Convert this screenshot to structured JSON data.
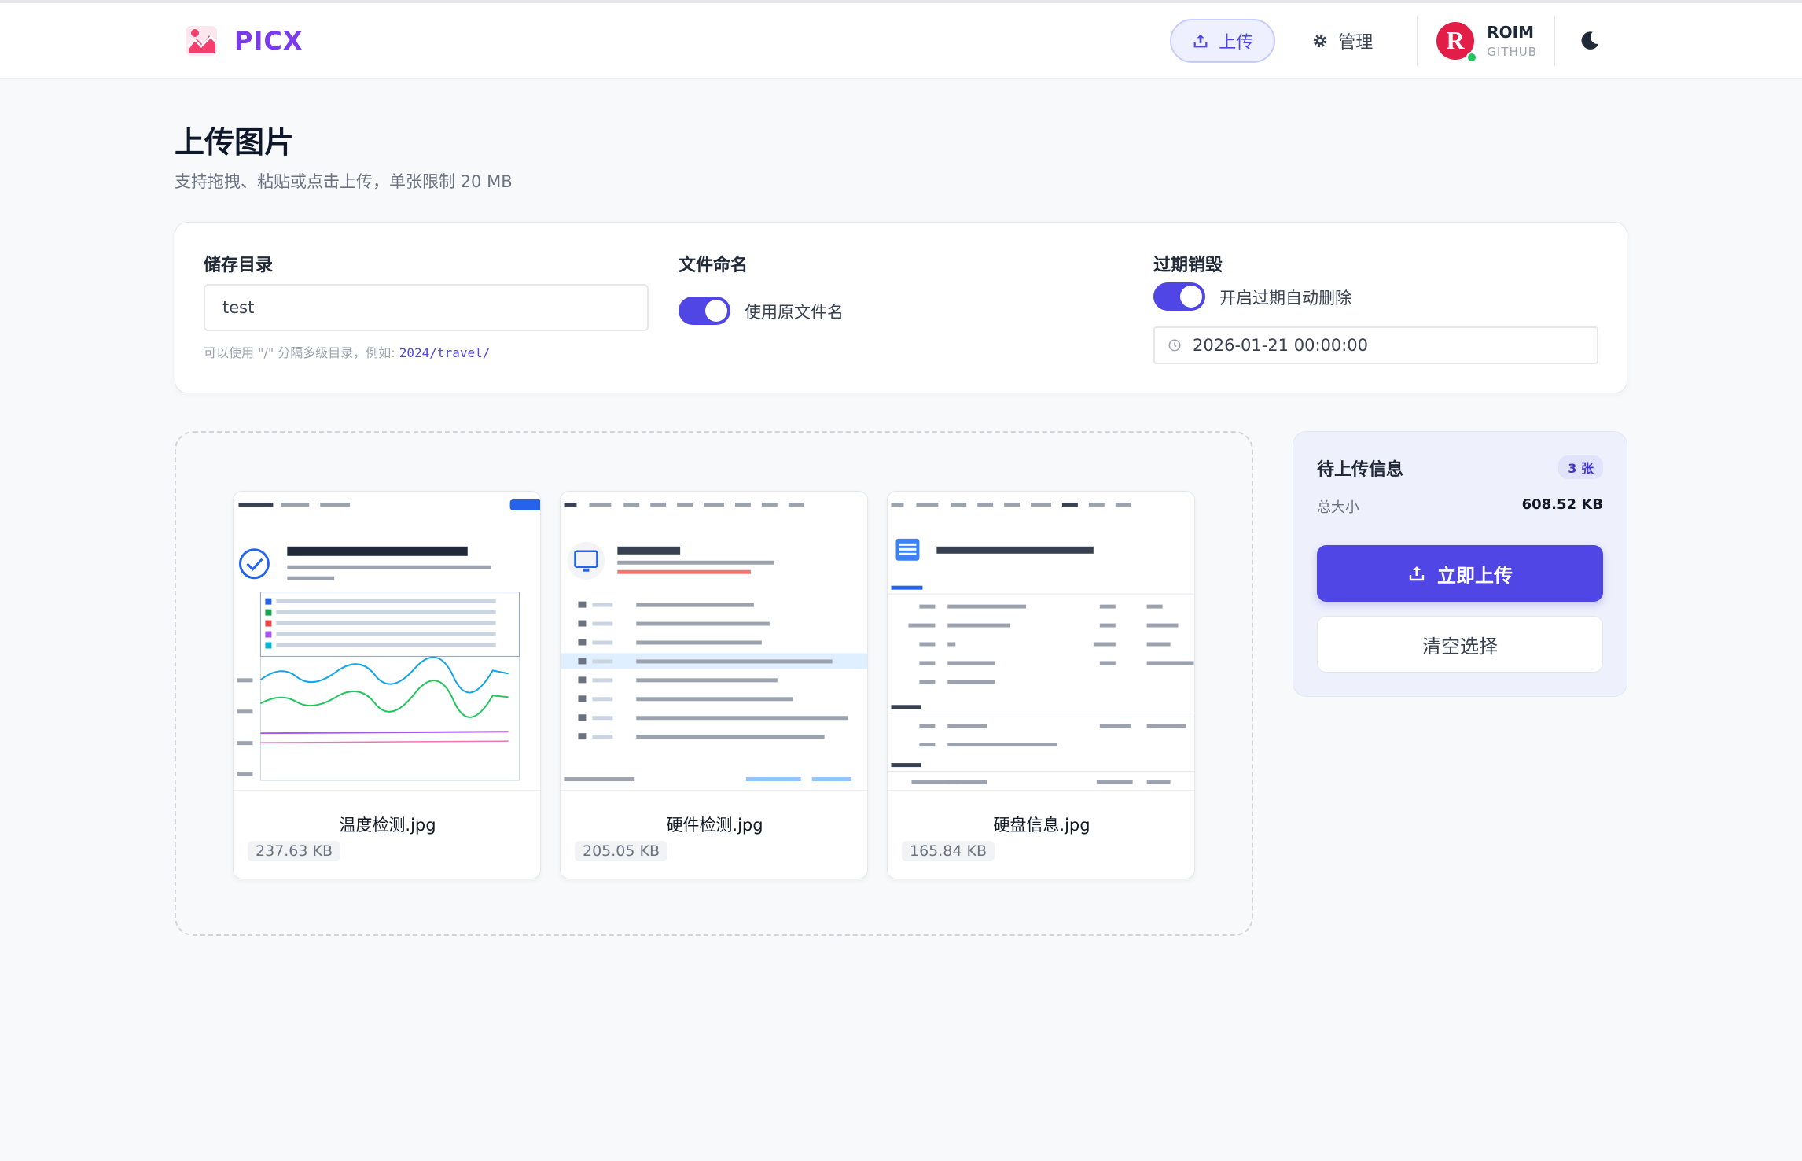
{
  "app": {
    "name": "PICX"
  },
  "nav": {
    "upload_label": "上传",
    "manage_label": "管理"
  },
  "user": {
    "name": "ROIM",
    "source": "GITHUB"
  },
  "page": {
    "title": "上传图片",
    "subtitle": "支持拖拽、粘贴或点击上传，单张限制 20 MB"
  },
  "settings": {
    "dir_label": "储存目录",
    "dir_value": "test",
    "dir_hint_prefix": "可以使用 \"/\" 分隔多级目录，例如: ",
    "dir_hint_example": "2024/travel/",
    "naming_label": "文件命名",
    "naming_toggle_text": "使用原文件名",
    "naming_enabled": true,
    "expire_label": "过期销毁",
    "expire_toggle_text": "开启过期自动删除",
    "expire_enabled": true,
    "expire_datetime": "2026-01-21 00:00:00"
  },
  "files": [
    {
      "name": "温度检测.jpg",
      "size": "237.63 KB"
    },
    {
      "name": "硬件检测.jpg",
      "size": "205.05 KB"
    },
    {
      "name": "硬盘信息.jpg",
      "size": "165.84 KB"
    }
  ],
  "panel": {
    "title": "待上传信息",
    "count_badge": "3 张",
    "total_label": "总大小",
    "total_value": "608.52 KB",
    "upload_button": "立即上传",
    "clear_button": "清空选择"
  },
  "colors": {
    "accent": "#4f46e5",
    "brand": "#7c3aed",
    "online": "#22c55e"
  },
  "icons": [
    "app-logo-icon",
    "upload-icon",
    "gear-icon",
    "github-avatar-icon",
    "moon-icon",
    "clock-icon"
  ]
}
